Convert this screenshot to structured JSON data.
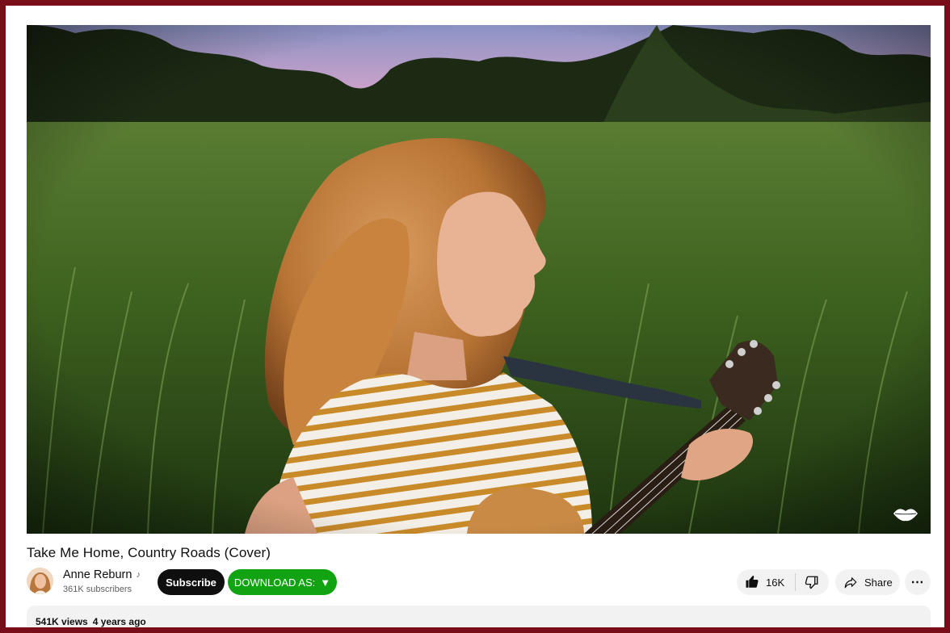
{
  "video": {
    "title": "Take Me Home, Country Roads (Cover)"
  },
  "channel": {
    "name": "Anne Reburn",
    "badge_icon": "music-note-icon",
    "subscribers": "361K subscribers"
  },
  "actions": {
    "subscribe_label": "Subscribe",
    "download_label": "DOWNLOAD AS:",
    "download_arrow": "▼",
    "like_count": "16K",
    "share_label": "Share",
    "more_label": "⋯"
  },
  "description": {
    "views": "541K views",
    "age": "4 years ago"
  },
  "colors": {
    "frame": "#7a0e18",
    "download_button": "#12a312",
    "subscribe_button": "#0f0f0f"
  }
}
